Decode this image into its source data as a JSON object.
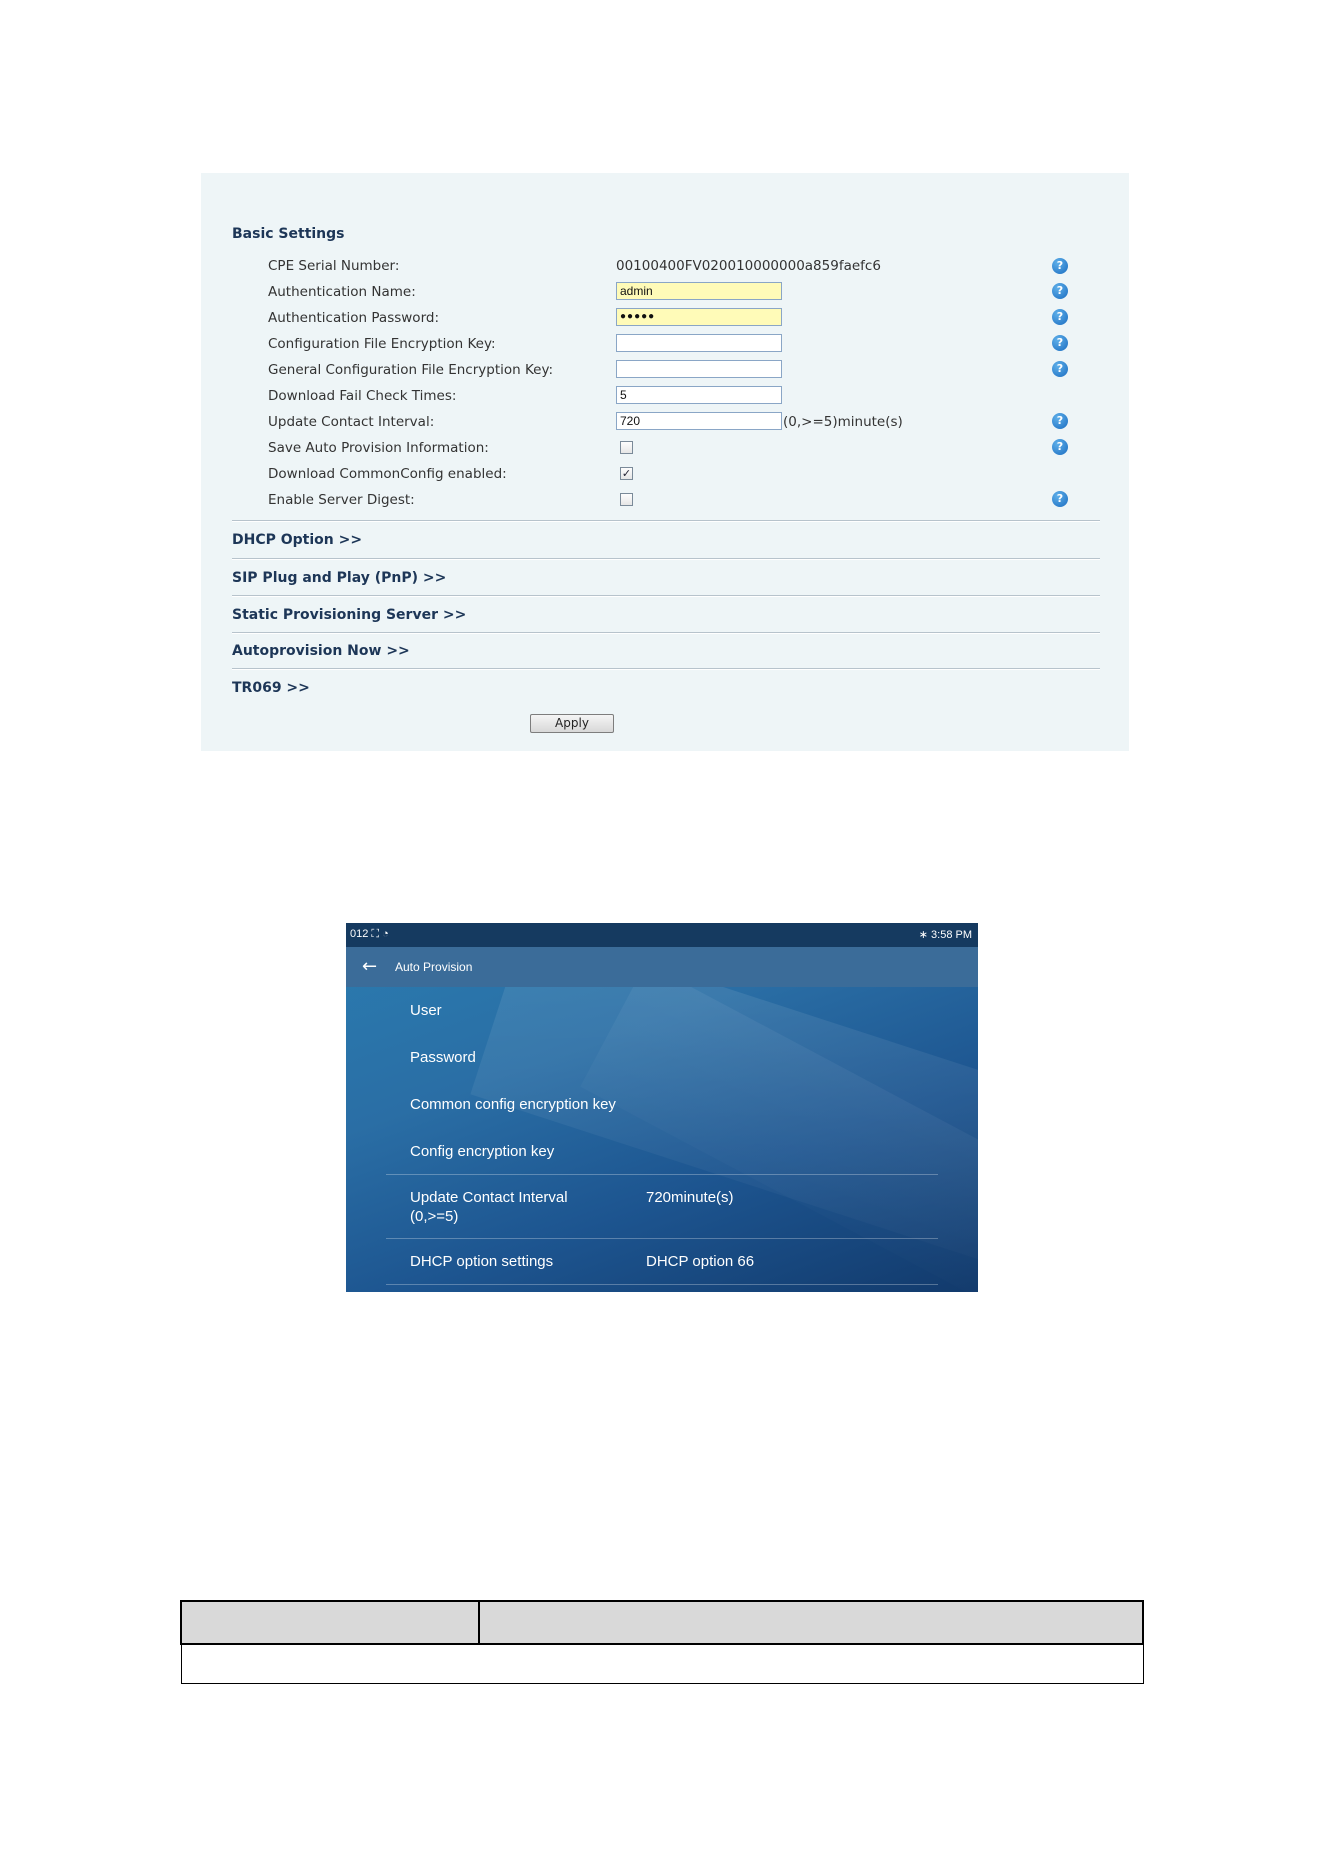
{
  "web": {
    "basic_settings_title": "Basic Settings",
    "rows": {
      "cpe_serial_label": "CPE Serial Number:",
      "cpe_serial_value": "00100400FV020010000000a859faefc6",
      "auth_name_label": "Authentication Name:",
      "auth_name_value": "admin",
      "auth_password_label": "Authentication Password:",
      "auth_password_value": "●●●●●",
      "config_key_label": "Configuration File Encryption Key:",
      "config_key_value": "",
      "general_key_label": "General Configuration File Encryption Key:",
      "general_key_value": "",
      "fail_check_label": "Download Fail Check Times:",
      "fail_check_value": "5",
      "update_interval_label": "Update Contact Interval:",
      "update_interval_value": "720",
      "update_interval_unit": "(0,>=5)minute(s)",
      "save_auto_label": "Save Auto Provision Information:",
      "save_auto_checked": false,
      "download_common_label": "Download CommonConfig enabled:",
      "download_common_checked": true,
      "server_digest_label": "Enable Server Digest:",
      "server_digest_checked": false
    },
    "checkmark": "✓",
    "help_glyph": "?",
    "sections": {
      "dhcp": "DHCP Option >>",
      "sip_pnp": "SIP Plug and Play (PnP) >>",
      "static_server": "Static Provisioning Server >>",
      "autoprovision_now": "Autoprovision Now >>",
      "tr069": "TR069 >>"
    },
    "apply_label": "Apply"
  },
  "phone": {
    "status_left": "012 ⛶ ◔",
    "status_right": "∗ 3:58 PM",
    "back_icon": "←",
    "title": "Auto Provision",
    "items": {
      "user": "User",
      "password": "Password",
      "common_key": "Common config encryption key",
      "config_key": "Config encryption key",
      "update_interval_line1": "Update Contact Interval",
      "update_interval_line2": "(0,>=5)",
      "update_interval_value": "720minute(s)",
      "dhcp_label": "DHCP option settings",
      "dhcp_value": "DHCP option 66"
    }
  },
  "table": {
    "header_col1": "",
    "header_col2": "",
    "row1": ""
  }
}
